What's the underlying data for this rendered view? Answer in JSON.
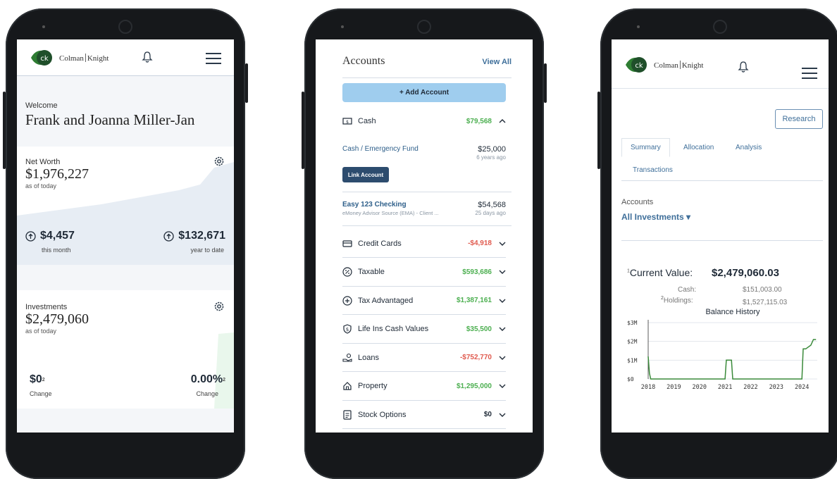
{
  "brand": {
    "name_left": "Colman",
    "name_right": "Knight",
    "accent": "#2e7d32"
  },
  "phone1": {
    "welcome_label": "Welcome",
    "client_name": "Frank and Joanna Miller-Jan",
    "net_worth": {
      "label": "Net Worth",
      "value": "$1,976,227",
      "sub": "as of today"
    },
    "month": {
      "value": "$4,457",
      "label": "this month"
    },
    "ytd": {
      "value": "$132,671",
      "label": "year to date"
    },
    "investments": {
      "label": "Investments",
      "value": "$2,479,060",
      "sub": "as of today"
    },
    "change_amount": {
      "value": "$0",
      "sup": "2",
      "label": "Change"
    },
    "change_pct": {
      "value": "0.00%",
      "sup": "2",
      "label": "Change"
    }
  },
  "phone2": {
    "title": "Accounts",
    "view_all": "View All",
    "add_account": "+ Add Account",
    "cash": {
      "name": "Cash",
      "amount": "$79,568"
    },
    "emergency": {
      "name": "Cash / Emergency Fund",
      "amount": "$25,000",
      "date": "6 years ago"
    },
    "link_account": "Link Account",
    "checking": {
      "name": "Easy 123 Checking",
      "amount": "$54,568",
      "desc": "eMoney Advisor Source (EMA) - Client ...",
      "date": "25 days ago"
    },
    "rows": [
      {
        "name": "Credit Cards",
        "amount": "-$4,918",
        "tone": "neg",
        "icon": "credit-card-icon"
      },
      {
        "name": "Taxable",
        "amount": "$593,686",
        "tone": "pos",
        "icon": "percent-icon"
      },
      {
        "name": "Tax Advantaged",
        "amount": "$1,387,161",
        "tone": "pos",
        "icon": "plus-circle-icon"
      },
      {
        "name": "Life Ins Cash Values",
        "amount": "$35,500",
        "tone": "pos",
        "icon": "dollar-shield-icon"
      },
      {
        "name": "Loans",
        "amount": "-$752,770",
        "tone": "neg",
        "icon": "hand-coins-icon"
      },
      {
        "name": "Property",
        "amount": "$1,295,000",
        "tone": "pos",
        "icon": "house-icon"
      },
      {
        "name": "Stock Options",
        "amount": "$0",
        "tone": "neu",
        "icon": "document-icon"
      }
    ]
  },
  "phone3": {
    "research": "Research",
    "tabs": [
      "Summary",
      "Allocation",
      "Analysis",
      "Transactions"
    ],
    "accounts_label": "Accounts",
    "accounts_value": "All Investments ▾",
    "current_value_label": "Current Value:",
    "current_value_sup": "1",
    "current_value": "$2,479,060.03",
    "cash_label": "Cash:",
    "cash_value": "$151,003.00",
    "holdings_label": "Holdings:",
    "holdings_sup": "2",
    "holdings_value": "$1,527,115.03",
    "chart_data": {
      "type": "line",
      "title": "Balance History",
      "x_ticks": [
        "2018",
        "2019",
        "2020",
        "2021",
        "2022",
        "2023",
        "2024"
      ],
      "y_ticks": [
        "$0",
        "$1M",
        "$2M",
        "$3M"
      ],
      "ylim": [
        0,
        3
      ],
      "xlim": [
        2018,
        2024.6
      ],
      "grid": true,
      "color": "#3a8a3a",
      "series": [
        {
          "x": [
            2018.0,
            2018.05,
            2018.1,
            2021.0,
            2021.05,
            2021.25,
            2021.3,
            2024.0,
            2024.05,
            2024.15,
            2024.35,
            2024.45,
            2024.55
          ],
          "y": [
            1.2,
            0.3,
            0,
            0,
            1.0,
            1.0,
            0,
            0,
            1.6,
            1.6,
            1.8,
            2.1,
            2.1
          ]
        }
      ]
    }
  }
}
